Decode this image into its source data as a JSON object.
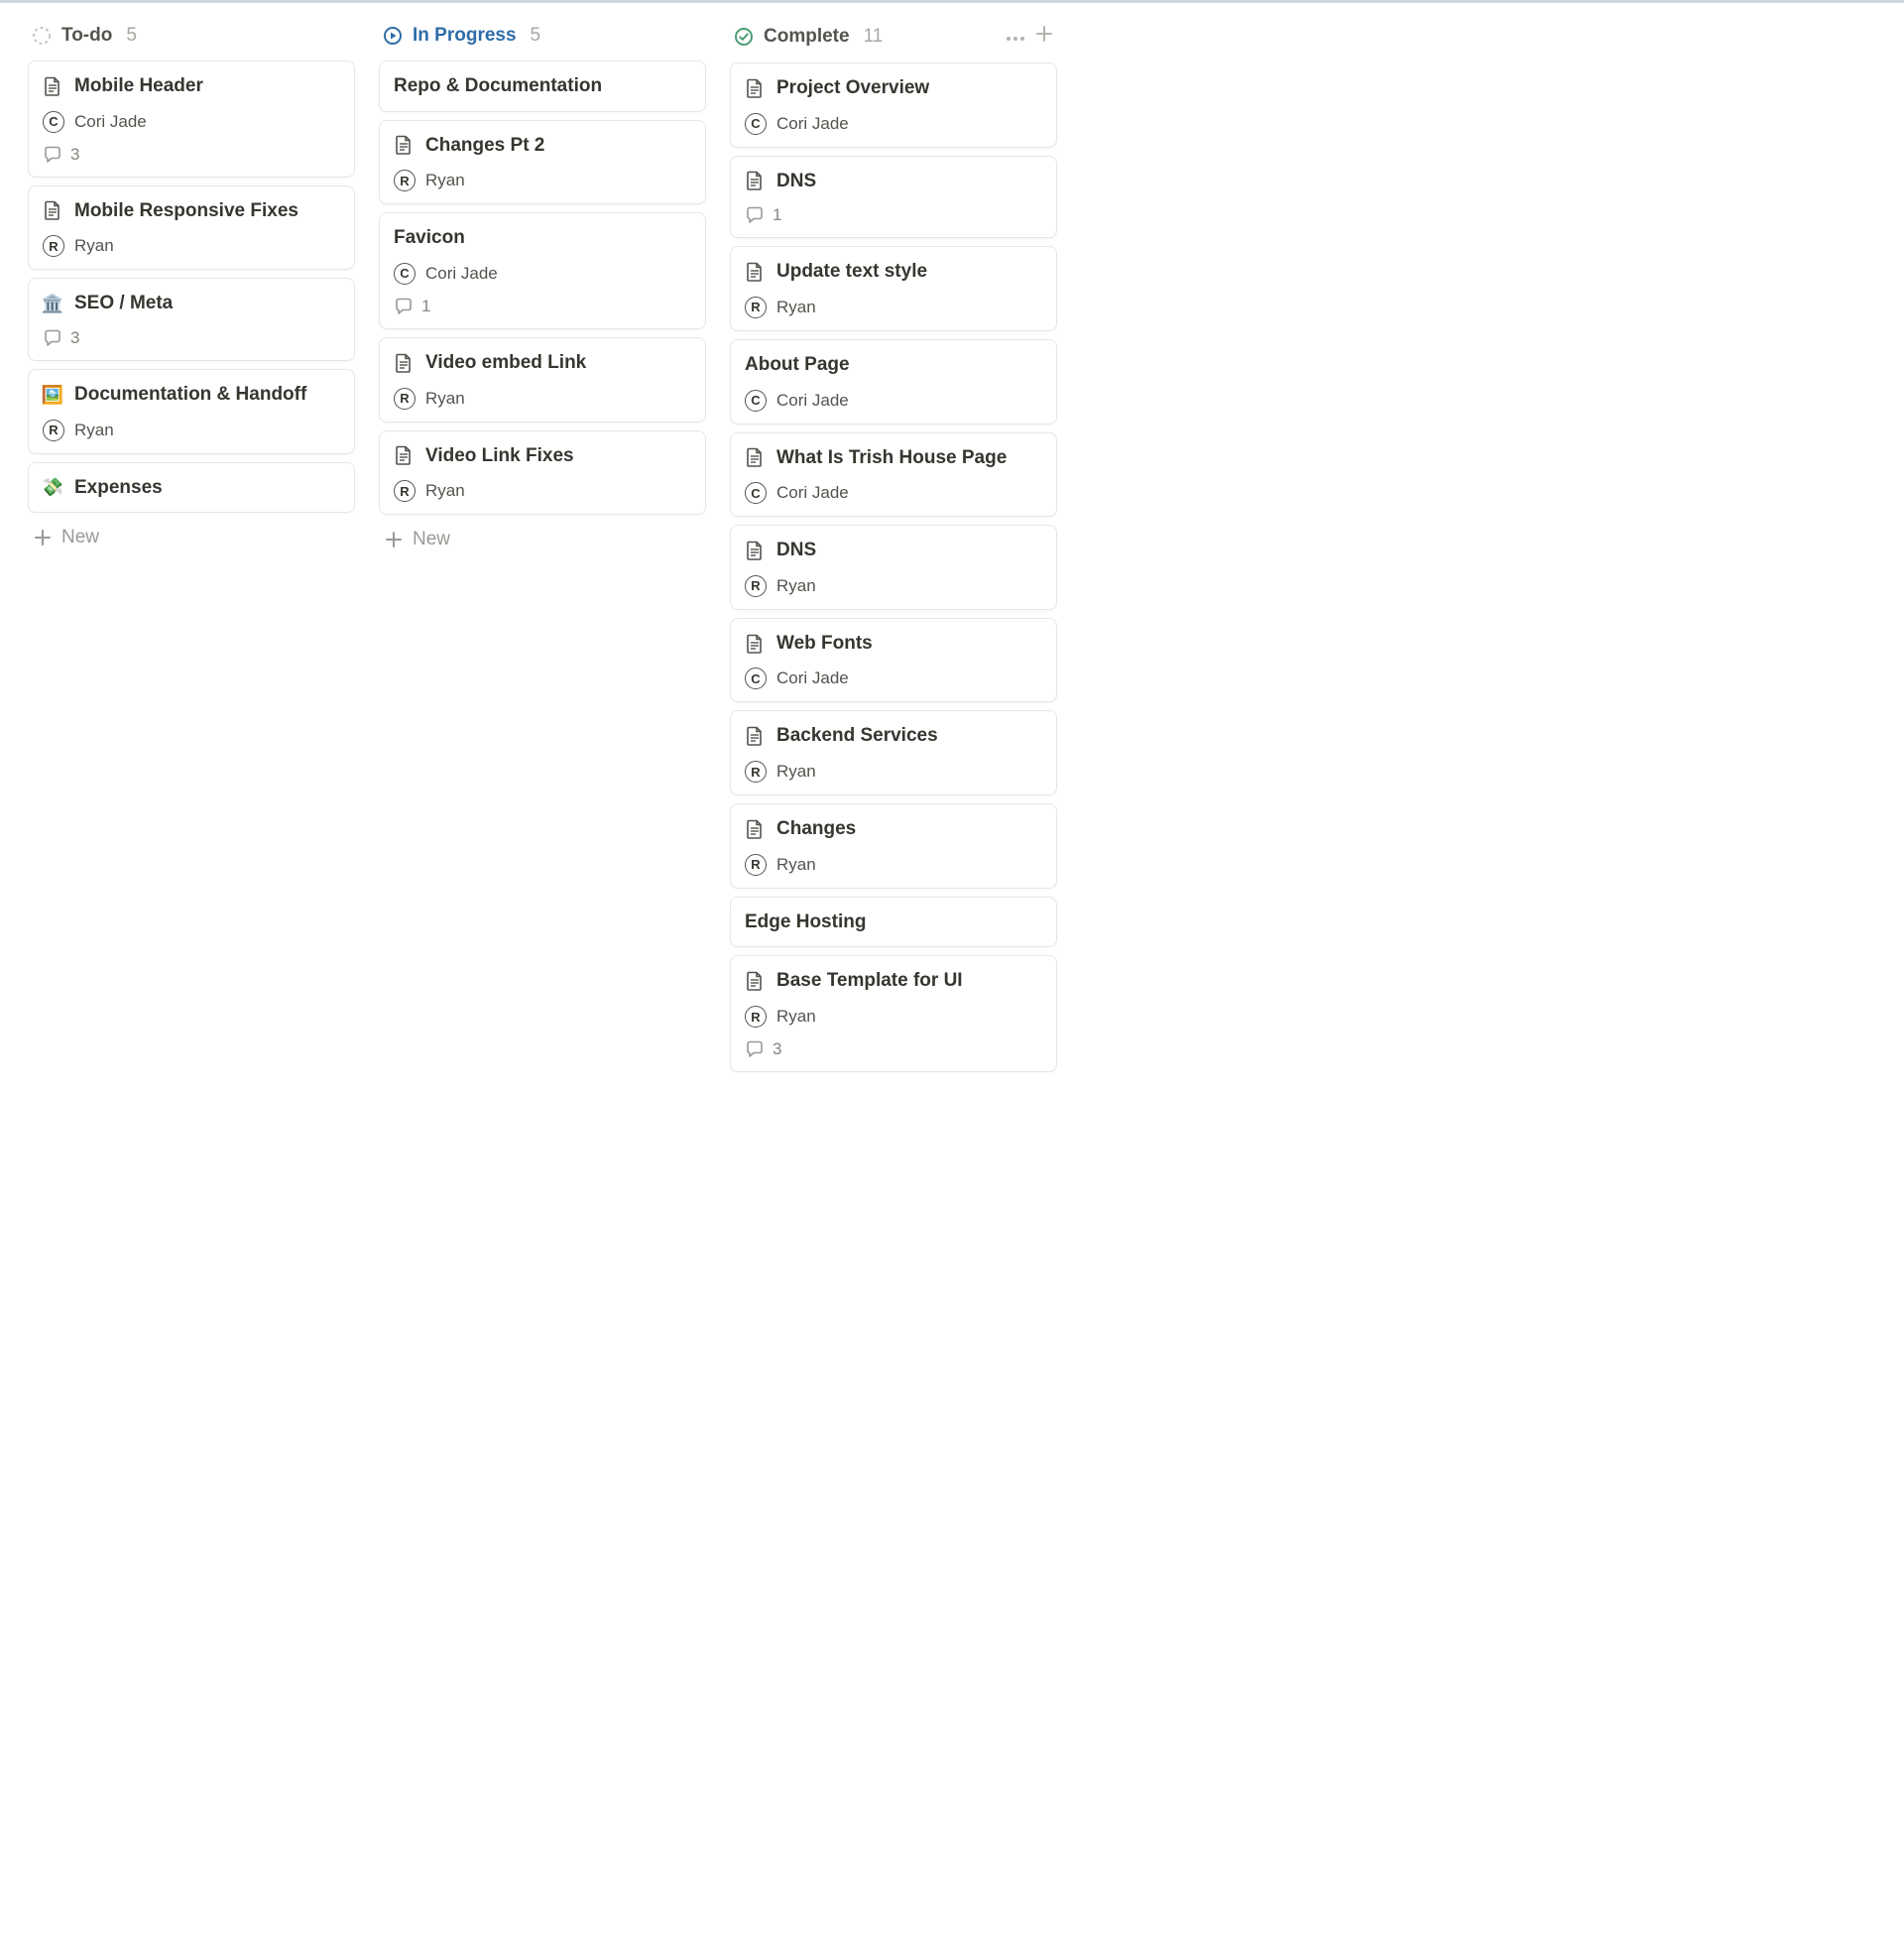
{
  "new_label": "New",
  "columns": [
    {
      "key": "todo",
      "title": "To-do",
      "count": "5",
      "status_style": "todo",
      "show_actions": false,
      "show_new": true,
      "cards": [
        {
          "title": "Mobile Header",
          "icon": "doc",
          "assignee": {
            "initial": "C",
            "name": "Cori Jade"
          },
          "comments": "3"
        },
        {
          "title": "Mobile Responsive Fixes",
          "icon": "doc",
          "assignee": {
            "initial": "R",
            "name": "Ryan"
          }
        },
        {
          "title": "SEO / Meta",
          "icon": "emoji",
          "emoji": "🏛️",
          "comments": "3"
        },
        {
          "title": "Documentation & Handoff",
          "icon": "emoji",
          "emoji": "🖼️",
          "assignee": {
            "initial": "R",
            "name": "Ryan"
          }
        },
        {
          "title": "Expenses",
          "icon": "emoji",
          "emoji": "💸"
        }
      ]
    },
    {
      "key": "inprogress",
      "title": "In Progress",
      "count": "5",
      "status_style": "inprogress",
      "show_actions": false,
      "show_new": true,
      "cards": [
        {
          "title": "Repo & Documentation"
        },
        {
          "title": "Changes Pt 2",
          "icon": "doc",
          "assignee": {
            "initial": "R",
            "name": "Ryan"
          }
        },
        {
          "title": "Favicon",
          "assignee": {
            "initial": "C",
            "name": "Cori Jade"
          },
          "comments": "1"
        },
        {
          "title": "Video embed Link",
          "icon": "doc",
          "assignee": {
            "initial": "R",
            "name": "Ryan"
          }
        },
        {
          "title": "Video Link Fixes",
          "icon": "doc",
          "assignee": {
            "initial": "R",
            "name": "Ryan"
          }
        }
      ]
    },
    {
      "key": "complete",
      "title": "Complete",
      "count": "11",
      "status_style": "complete",
      "show_actions": true,
      "show_new": false,
      "cards": [
        {
          "title": "Project Overview",
          "icon": "doc",
          "assignee": {
            "initial": "C",
            "name": "Cori Jade"
          }
        },
        {
          "title": "DNS",
          "icon": "doc",
          "comments": "1"
        },
        {
          "title": "Update text style",
          "icon": "doc",
          "assignee": {
            "initial": "R",
            "name": "Ryan"
          }
        },
        {
          "title": "About Page",
          "assignee": {
            "initial": "C",
            "name": "Cori Jade"
          }
        },
        {
          "title": "What Is Trish House Page",
          "icon": "doc",
          "assignee": {
            "initial": "C",
            "name": "Cori Jade"
          }
        },
        {
          "title": "DNS",
          "icon": "doc",
          "assignee": {
            "initial": "R",
            "name": "Ryan"
          }
        },
        {
          "title": "Web Fonts",
          "icon": "doc",
          "assignee": {
            "initial": "C",
            "name": "Cori Jade"
          }
        },
        {
          "title": "Backend Services",
          "icon": "doc",
          "assignee": {
            "initial": "R",
            "name": "Ryan"
          }
        },
        {
          "title": "Changes",
          "icon": "doc",
          "assignee": {
            "initial": "R",
            "name": "Ryan"
          }
        },
        {
          "title": "Edge Hosting"
        },
        {
          "title": "Base Template for UI",
          "icon": "doc",
          "assignee": {
            "initial": "R",
            "name": "Ryan"
          },
          "comments": "3"
        }
      ]
    }
  ]
}
